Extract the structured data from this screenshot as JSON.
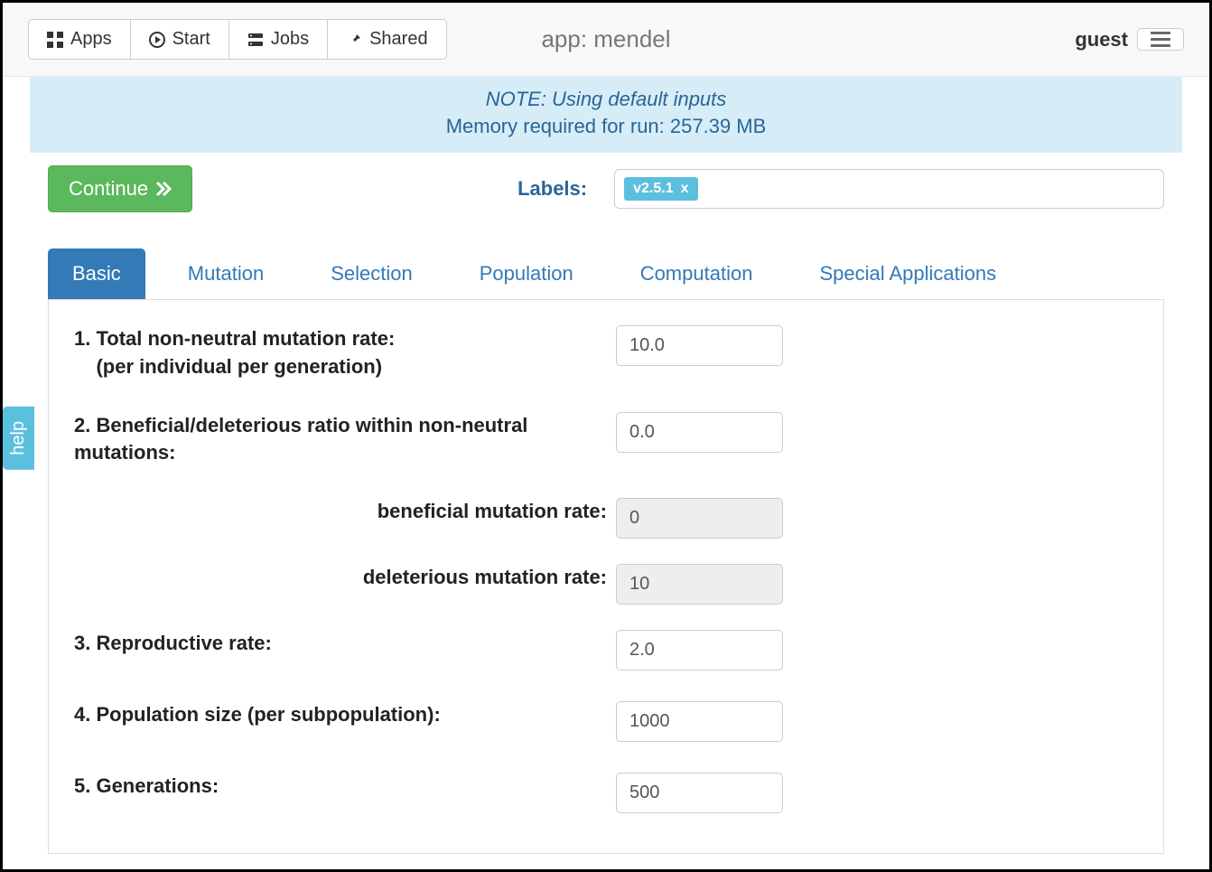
{
  "nav": {
    "apps": "Apps",
    "start": "Start",
    "jobs": "Jobs",
    "shared": "Shared",
    "app_title": "app: mendel",
    "guest": "guest"
  },
  "banner": {
    "note": "NOTE: Using default inputs",
    "memory": "Memory required for run: 257.39 MB"
  },
  "actions": {
    "continue": "Continue",
    "labels_label": "Labels:",
    "tag_value": "v2.5.1",
    "tag_remove": "x"
  },
  "tabs": [
    {
      "label": "Basic",
      "active": true
    },
    {
      "label": "Mutation",
      "active": false
    },
    {
      "label": "Selection",
      "active": false
    },
    {
      "label": "Population",
      "active": false
    },
    {
      "label": "Computation",
      "active": false
    },
    {
      "label": "Special Applications",
      "active": false
    }
  ],
  "form": {
    "f1_label": "1. Total non-neutral mutation rate:\n(per individual per generation)",
    "f1_value": "10.0",
    "f2_label": "2. Beneficial/deleterious ratio within non-neutral mutations:",
    "f2_value": "0.0",
    "f2a_label": "beneficial mutation rate:",
    "f2a_value": "0",
    "f2b_label": "deleterious mutation rate:",
    "f2b_value": "10",
    "f3_label": "3. Reproductive rate:",
    "f3_value": "2.0",
    "f4_label": "4. Population size (per subpopulation):",
    "f4_value": "1000",
    "f5_label": "5. Generations:",
    "f5_value": "500"
  },
  "help": "help"
}
